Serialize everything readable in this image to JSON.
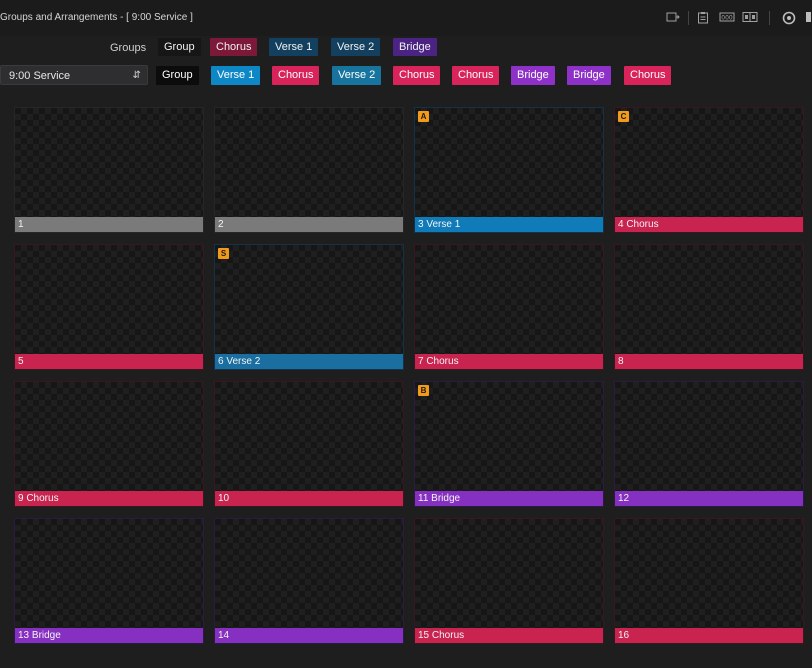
{
  "window": {
    "title": "Groups and Arrangements - [ 9:00 Service ]"
  },
  "toolbar_icons": [
    "import-icon",
    "clipboard-icon",
    "bible-icon",
    "split-view-icon",
    "settings-icon"
  ],
  "groups_row": {
    "label": "Groups",
    "chips": [
      {
        "text": "Group",
        "kind": "g"
      },
      {
        "text": "Chorus",
        "kind": "ch"
      },
      {
        "text": "Verse 1",
        "kind": "v1"
      },
      {
        "text": "Verse 2",
        "kind": "v2"
      },
      {
        "text": "Bridge",
        "kind": "br"
      }
    ]
  },
  "arrangement": {
    "selected": "9:00 Service",
    "chips": [
      {
        "text": "Group",
        "kind": "g"
      },
      {
        "text": "Verse 1",
        "kind": "v1"
      },
      {
        "text": "Chorus",
        "kind": "ch"
      },
      {
        "text": "Verse 2",
        "kind": "v2"
      },
      {
        "text": "Chorus",
        "kind": "ch"
      },
      {
        "text": "Chorus",
        "kind": "ch"
      },
      {
        "text": "Bridge",
        "kind": "br"
      },
      {
        "text": "Bridge",
        "kind": "br"
      },
      {
        "text": "Chorus",
        "kind": "ch"
      }
    ]
  },
  "slides": [
    {
      "label": "1",
      "group": "none",
      "hotkey": ""
    },
    {
      "label": "2",
      "group": "none",
      "hotkey": ""
    },
    {
      "label": "3  Verse 1",
      "group": "v1",
      "hotkey": "A"
    },
    {
      "label": "4  Chorus",
      "group": "ch",
      "hotkey": "C"
    },
    {
      "label": "5",
      "group": "ch",
      "hotkey": ""
    },
    {
      "label": "6  Verse 2",
      "group": "v2",
      "hotkey": "S"
    },
    {
      "label": "7  Chorus",
      "group": "ch",
      "hotkey": ""
    },
    {
      "label": "8",
      "group": "ch",
      "hotkey": ""
    },
    {
      "label": "9  Chorus",
      "group": "ch",
      "hotkey": ""
    },
    {
      "label": "10",
      "group": "ch",
      "hotkey": ""
    },
    {
      "label": "11  Bridge",
      "group": "br",
      "hotkey": "B"
    },
    {
      "label": "12",
      "group": "br",
      "hotkey": ""
    },
    {
      "label": "13  Bridge",
      "group": "br",
      "hotkey": ""
    },
    {
      "label": "14",
      "group": "br",
      "hotkey": ""
    },
    {
      "label": "15  Chorus",
      "group": "ch",
      "hotkey": ""
    },
    {
      "label": "16",
      "group": "ch",
      "hotkey": ""
    }
  ],
  "colors": {
    "chorus": "#c8244f",
    "verse1": "#0f7bb8",
    "verse2": "#1a6ea0",
    "bridge": "#8630c1",
    "hotkey": "#f29a1a"
  }
}
